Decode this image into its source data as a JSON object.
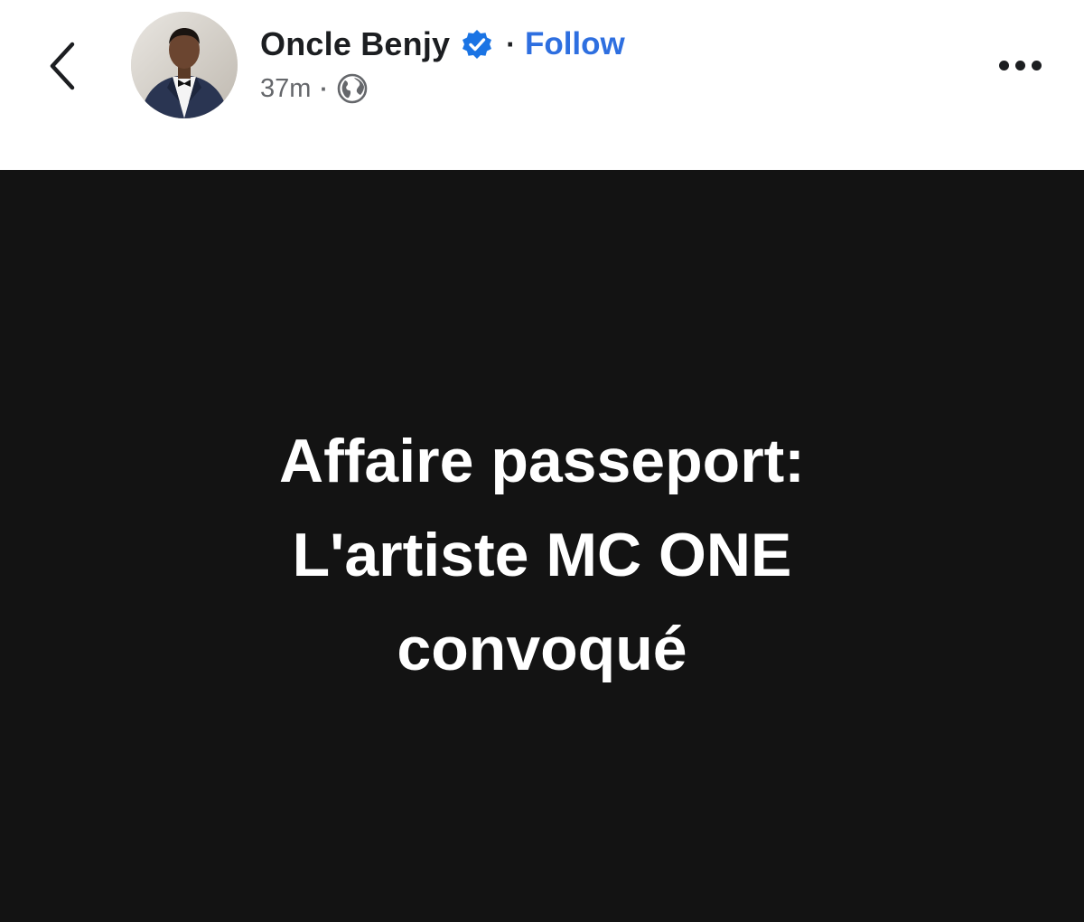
{
  "header": {
    "author_name": "Oncle Benjy",
    "separator": "·",
    "follow_label": "Follow",
    "post_time": "37m",
    "meta_separator": "·",
    "icons": {
      "back": "chevron-left-icon",
      "verified": "verified-badge-icon",
      "audience": "globe-icon",
      "more": "more-horizontal-icon"
    },
    "colors": {
      "follow": "#2e6fe0",
      "verified": "#1b74e4"
    }
  },
  "post": {
    "background": "#131313",
    "text_lines": [
      "Affaire passeport:",
      "L'artiste MC ONE",
      "convoqué"
    ]
  }
}
